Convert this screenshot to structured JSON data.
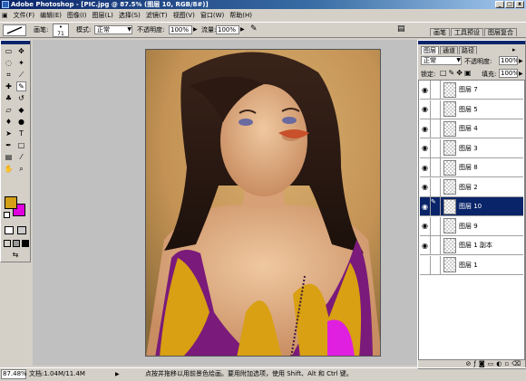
{
  "window": {
    "title": "Adobe Photoshop - [PIC.jpg @ 87.5% (图层 10, RGB/8#)]",
    "min": "_",
    "max": "□",
    "close": "x"
  },
  "menu": [
    "文件(F)",
    "编辑(E)",
    "图像(I)",
    "图层(L)",
    "选择(S)",
    "滤镜(T)",
    "视图(V)",
    "窗口(W)",
    "帮助(H)"
  ],
  "options": {
    "brush_label": "画笔:",
    "brush_size": "71",
    "mode_label": "模式:",
    "mode_value": "正常",
    "opacity_label": "不透明度:",
    "opacity_value": "100%",
    "flow_label": "流量:",
    "flow_value": "100%",
    "tabs": [
      "画笔",
      "工具预设",
      "图层复合"
    ]
  },
  "layers_panel": {
    "tabs": [
      "图层",
      "通道",
      "路径"
    ],
    "blend_mode": "正常",
    "opacity_label": "不透明度:",
    "opacity_value": "100%",
    "lock_label": "锁定:",
    "fill_label": "填充:",
    "fill_value": "100%",
    "layers": [
      {
        "name": "图层 7",
        "selected": false
      },
      {
        "name": "图层 5",
        "selected": false
      },
      {
        "name": "图层 4",
        "selected": false
      },
      {
        "name": "图层 3",
        "selected": false
      },
      {
        "name": "图层 8",
        "selected": false
      },
      {
        "name": "图层 2",
        "selected": false
      },
      {
        "name": "图层 10",
        "selected": true
      },
      {
        "name": "图层 9",
        "selected": false
      },
      {
        "name": "图层 1 副本",
        "selected": false
      },
      {
        "name": "图层 1",
        "selected": false
      }
    ]
  },
  "status": {
    "zoom": "87.48%",
    "doc_info": "文档:1.04M/11.4M",
    "hint": "点按并拖移以用前景色绘画。要用附加选项，使用 Shift、Alt 和 Ctrl 键。"
  },
  "colors": {
    "foreground": "#d4a017",
    "background": "#e000e0"
  }
}
